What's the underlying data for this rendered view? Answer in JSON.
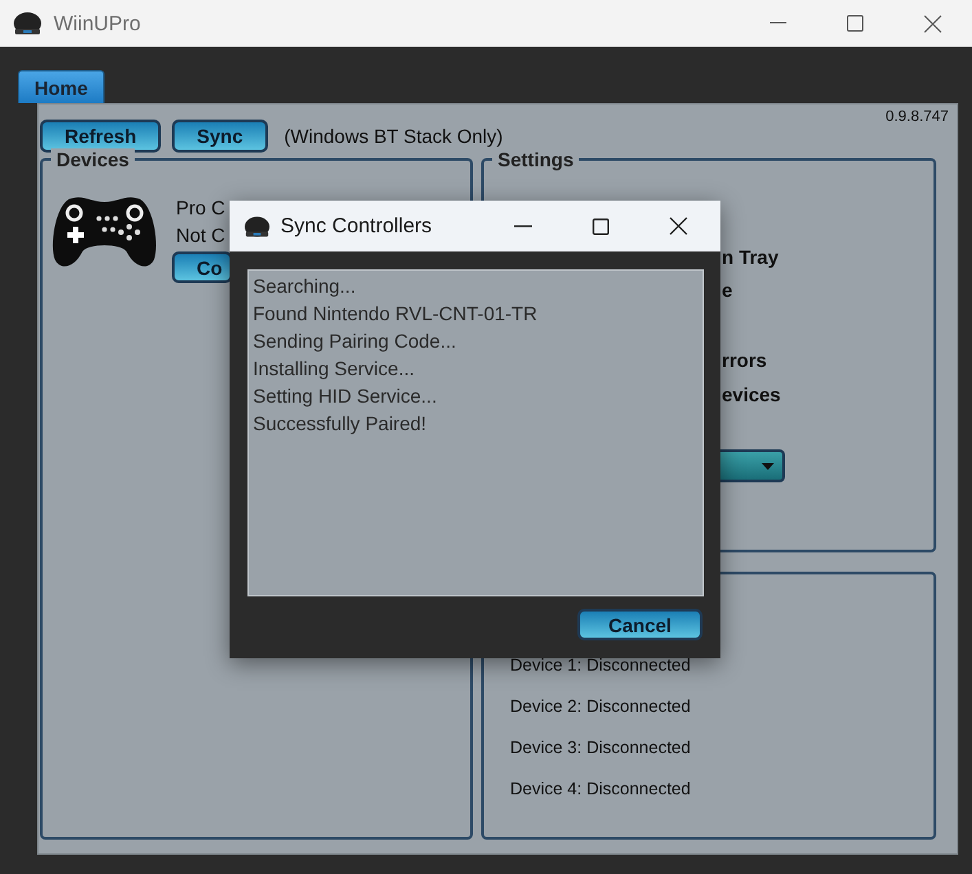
{
  "window": {
    "title": "WiinUPro"
  },
  "tabs": [
    {
      "label": "Home",
      "selected": true
    }
  ],
  "toolbar": {
    "buttons": [
      "Refresh",
      "Sync"
    ],
    "note": "(Windows BT Stack Only)",
    "version": "0.9.8.747"
  },
  "devices": {
    "title": "Devices",
    "name": "Pro C",
    "status": "Not C",
    "button": "Co"
  },
  "settings": {
    "title": "Settings",
    "items": [
      "n Tray",
      "e",
      "rrors",
      "evices"
    ]
  },
  "device_status": [
    "Device 1: Disconnected",
    "Device 2: Disconnected",
    "Device 3: Disconnected",
    "Device 4: Disconnected"
  ],
  "dialog": {
    "title": "Sync Controllers",
    "log": [
      "Searching...",
      "Found Nintendo RVL-CNT-01-TR",
      "Sending Pairing Code...",
      "Installing Service...",
      "Setting HID Service...",
      "Successfully Paired!"
    ],
    "button": "Cancel"
  }
}
